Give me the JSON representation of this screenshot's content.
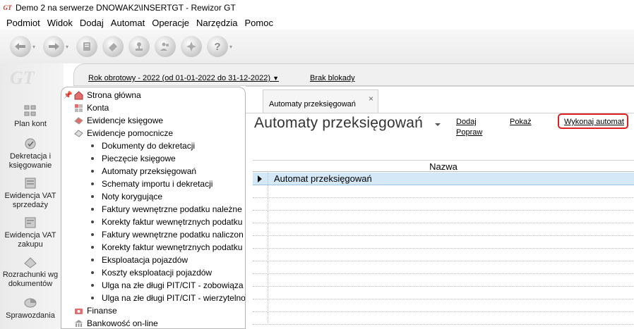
{
  "window": {
    "title": "Demo 2 na serwerze DNOWAK2\\INSERTGT - Rewizor GT",
    "icon": "rewizor-gt-icon"
  },
  "menu": [
    "Podmiot",
    "Widok",
    "Dodaj",
    "Automat",
    "Operacje",
    "Narzędzia",
    "Pomoc"
  ],
  "toolbar": {
    "buttons": [
      "back-icon",
      "forward-icon",
      "ledger-icon",
      "eraser-icon",
      "stamp-icon",
      "people-icon",
      "transfer-icon",
      "help-icon"
    ]
  },
  "sidebar": {
    "logo": "GT",
    "items": [
      {
        "label": "Plan kont",
        "icon": "chart-of-accounts-icon"
      },
      {
        "label": "Dekretacja i księgowanie",
        "icon": "posting-icon"
      },
      {
        "label": "Ewidencja VAT sprzedaży",
        "icon": "vat-sales-icon"
      },
      {
        "label": "Ewidencja VAT zakupu",
        "icon": "vat-purchase-icon"
      },
      {
        "label": "Rozrachunki wg dokumentów",
        "icon": "settlements-icon"
      },
      {
        "label": "Sprawozdania",
        "icon": "reports-icon"
      }
    ]
  },
  "filter": {
    "year": "Rok obrotowy - 2022  (od 01-01-2022 do 31-12-2022)",
    "lock": "Brak blokady"
  },
  "tree": {
    "top": [
      {
        "label": "Strona główna",
        "icon": "home-icon"
      },
      {
        "label": "Konta",
        "icon": "accounts-icon"
      },
      {
        "label": "Ewidencje księgowe",
        "icon": "book-icon"
      },
      {
        "label": "Ewidencje pomocnicze",
        "icon": "book-icon"
      }
    ],
    "sub": [
      "Dokumenty do dekretacji",
      "Pieczęcie księgowe",
      "Automaty przeksięgowań",
      "Schematy importu i dekretacji",
      "Noty korygujące",
      "Faktury wewnętrzne podatku należne",
      "Korekty faktur wewnętrznych podatku",
      "Faktury wewnętrzne podatku naliczon",
      "Korekty faktur wewnętrznych podatku",
      "Eksploatacja pojazdów",
      "Koszty eksploatacji pojazdów",
      "Ulga na złe długi PIT/CIT - zobowiąza",
      "Ulga na złe długi PIT/CIT - wierzytelno"
    ],
    "bottom": [
      {
        "label": "Finanse",
        "icon": "finance-icon"
      },
      {
        "label": "Bankowość on-line",
        "icon": "bank-icon"
      }
    ]
  },
  "tab": {
    "label": "Automaty przeksięgowań",
    "close": "×"
  },
  "page": {
    "title": "Automaty przeksięgowań",
    "actions": {
      "add": "Dodaj",
      "edit": "Popraw",
      "show": "Pokaż",
      "run": "Wykonaj automat"
    }
  },
  "grid": {
    "column": "Nazwa",
    "rows": [
      "Automat przeksięgowań"
    ]
  },
  "colors": {
    "highlight": "#d5e8f7",
    "run_outline": "#e02020"
  }
}
